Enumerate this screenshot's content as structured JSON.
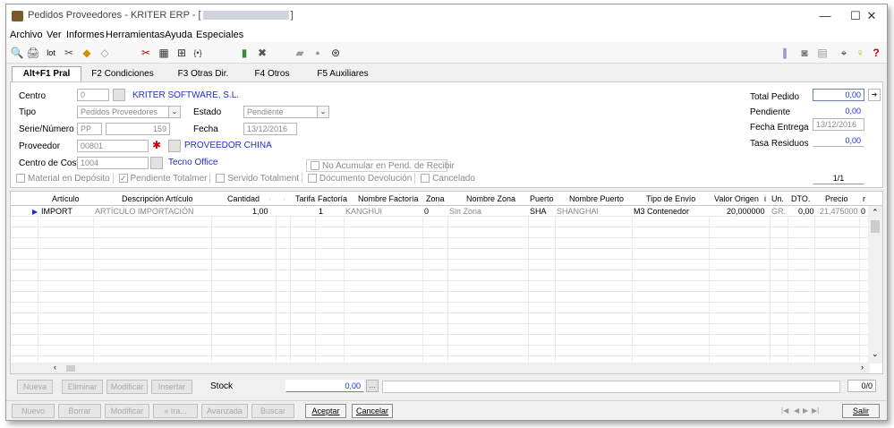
{
  "window": {
    "title": "Pedidos Proveedores - KRITER ERP - [",
    "title_end": "]",
    "controls": {
      "minimize": "—",
      "maximize": "☐",
      "close": "✕"
    }
  },
  "menu": [
    "Archivo",
    "Ver",
    "Informes",
    "Herramientas",
    "Ayuda",
    "Especiales"
  ],
  "toolbar": {
    "left": [
      {
        "name": "preview-icon",
        "glyph": "🔍"
      },
      {
        "name": "print-icon",
        "glyph": "🖨"
      },
      {
        "name": "lot-icon",
        "glyph": "lot"
      },
      {
        "name": "tools-icon",
        "glyph": "✂"
      },
      {
        "name": "bell-icon",
        "glyph": "◆"
      },
      {
        "name": "filter-icon",
        "glyph": "◇"
      },
      {
        "name": "scissors-icon",
        "glyph": "✂"
      },
      {
        "name": "grid-icon",
        "glyph": "▦"
      },
      {
        "name": "tree-icon",
        "glyph": "⊞"
      },
      {
        "name": "bracket-icon",
        "glyph": "{•}"
      },
      {
        "name": "bottle-icon",
        "glyph": "▮"
      },
      {
        "name": "cross-icon",
        "glyph": "✖"
      },
      {
        "name": "clip-icon",
        "glyph": "▰"
      },
      {
        "name": "circle-icon",
        "glyph": "●"
      },
      {
        "name": "search-icon",
        "glyph": "⊛"
      }
    ],
    "right": [
      {
        "name": "attach-icon",
        "glyph": "∥"
      },
      {
        "name": "camera-icon",
        "glyph": "◙"
      },
      {
        "name": "document-icon",
        "glyph": "▤"
      },
      {
        "name": "network-icon",
        "glyph": "⌖"
      },
      {
        "name": "lightbulb-icon",
        "glyph": "♀"
      },
      {
        "name": "help-icon",
        "glyph": "?"
      }
    ]
  },
  "tabs": [
    "Alt+F1 Pral",
    "F2 Condiciones",
    "F3 Otras Dir.",
    "F4 Otros",
    "F5 Auxiliares"
  ],
  "header": {
    "centro_label": "Centro",
    "centro_value": "0",
    "company_name": "KRITER SOFTWARE, S.L.",
    "tipo_label": "Tipo",
    "tipo_value": "Pedidos Proveedores",
    "estado_label": "Estado",
    "estado_value": "Pendiente",
    "serie_label": "Serie/Número",
    "serie_value": "PP",
    "numero_value": "159",
    "fecha_label": "Fecha",
    "fecha_value": "13/12/2016",
    "proveedor_label": "Proveedor",
    "proveedor_value": "00801",
    "proveedor_name": "PROVEEDOR CHINA",
    "coste_label": "Centro de Coste",
    "coste_value": "1004",
    "coste_name": "Tecno Office",
    "no_acumular": "No Acumular en Pend. de Recibir",
    "checks": [
      "Material en Depósito",
      "Pendiente Totalmer",
      "Servido Totalment",
      "Documento Devolución",
      "Cancelado"
    ],
    "total_label": "Total Pedido",
    "total_value": "0,00",
    "pendiente_label": "Pendiente",
    "pendiente_value": "0,00",
    "fecha_entrega_label": "Fecha Entrega",
    "fecha_entrega_value": "13/12/2016",
    "tasa_label": "Tasa Residuos",
    "tasa_value": "0,00",
    "pager": "1/1"
  },
  "grid": {
    "columns": [
      "Artículo",
      "Descripción Artículo",
      "Cantidad",
      "·",
      "·",
      "Tarifa",
      "Factoría",
      "Nombre Factoría",
      "Zona",
      "Nombre Zona",
      "Puerto",
      "Nombre Puerto",
      "Tipo de Envío",
      "Valor Origen",
      "i",
      "Un.",
      "DTO.",
      "Precio",
      "r"
    ],
    "rows": [
      {
        "articulo": "IMPORT",
        "descripcion": "ARTÍCULO IMPORTACIÓN",
        "cantidad": "1,00",
        "t1": "",
        "t2": "",
        "tarifa": "",
        "factoria": "1",
        "nombre_factoria": "KANGHUI",
        "zona": "0",
        "nombre_zona": "Sin Zona",
        "puerto": "SHA",
        "nombre_puerto": "SHANGHAI",
        "tipo_envio": "M3 Contenedor",
        "valor_origen": "20,000000",
        "i": "",
        "un": "GR.",
        "dto": "0,00",
        "precio": "21,475000",
        "r": "0"
      }
    ]
  },
  "grid_foot": {
    "buttons": [
      "Nueva",
      "Eliminar",
      "Modificar",
      "Insertar"
    ],
    "stock_label": "Stock",
    "stock_value": "0,00",
    "counter": "0/0"
  },
  "status": {
    "buttons": [
      "Nuevo",
      "Borrar",
      "Modificar",
      "« Ira...",
      "Avanzada",
      "Buscar"
    ],
    "aceptar": "Aceptar",
    "cancelar": "Cancelar",
    "salir": "Salir",
    "nav": [
      "|◀",
      "◀",
      "▶",
      "▶|"
    ]
  }
}
